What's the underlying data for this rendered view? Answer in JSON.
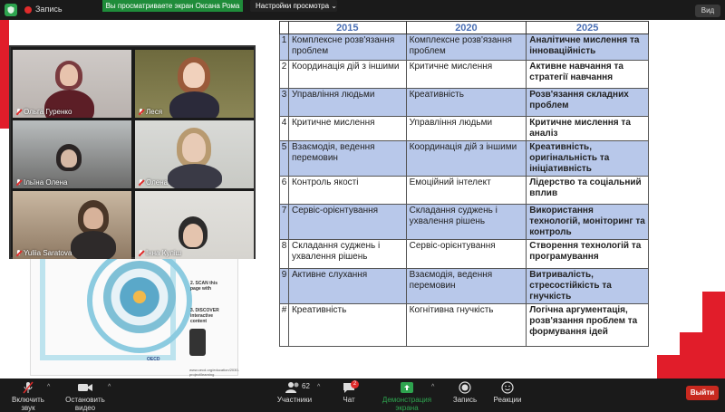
{
  "topbar": {
    "recording_label": "Запись",
    "share_banner": "Вы просматриваете экран Оксана Рома",
    "view_options": "Настройки просмотра ⌄",
    "view_button": "Вид"
  },
  "gallery": {
    "participants": [
      {
        "name": "Ольга Гуренко",
        "muted": true
      },
      {
        "name": "Леся",
        "muted": true
      },
      {
        "name": "Ільїна Олена",
        "muted": true
      },
      {
        "name": "Олена",
        "muted": true
      },
      {
        "name": "Yuliia Saratova",
        "muted": true
      },
      {
        "name": "Інна Куліш",
        "muted": true
      }
    ]
  },
  "infographic": {
    "scan_text": "2. SCAN this page with",
    "discover_text": "3. DISCOVER interactive content",
    "footer_url": "www.oecd.org/education/2030-project/learning",
    "logo_text": "OECD"
  },
  "table": {
    "headers": [
      "2015",
      "2020",
      "2025"
    ],
    "rows": [
      {
        "num": "1",
        "c2015": "Комплексне розв'язання проблем",
        "c2020": "Комплексне розв'язання проблем",
        "c2025": "Аналітичне мислення та інноваційність",
        "alt": true
      },
      {
        "num": "2",
        "c2015": "Координація дій з іншими",
        "c2020": "Критичне мислення",
        "c2025": "Активне навчання та стратегії навчання",
        "alt": false
      },
      {
        "num": "3",
        "c2015": "Управління людьми",
        "c2020": "Креативність",
        "c2025": "Розв'язання складних проблем",
        "alt": true
      },
      {
        "num": "4",
        "c2015": "Критичне мислення",
        "c2020": "Управління людьми",
        "c2025": "Критичне мислення та аналіз",
        "alt": false
      },
      {
        "num": "5",
        "c2015": "Взаємодія, ведення перемовин",
        "c2020": "Координація дій з іншими",
        "c2025": "Креативність, оригінальність та ініціативність",
        "alt": true
      },
      {
        "num": "6",
        "c2015": "Контроль якості",
        "c2020": "Емоційний інтелект",
        "c2025": "Лідерство та соціальний вплив",
        "alt": false
      },
      {
        "num": "7",
        "c2015": "Сервіс-орієнтування",
        "c2020": "Складання суджень і ухвалення рішень",
        "c2025": "Використання технологій, моніторинг та контроль",
        "alt": true
      },
      {
        "num": "8",
        "c2015": "Складання суджень і ухвалення рішень",
        "c2020": "Сервіс-орієнтування",
        "c2025": "Створення технологій та програмування",
        "alt": false
      },
      {
        "num": "9",
        "c2015": "Активне слухання",
        "c2020": "Взаємодія, ведення перемовин",
        "c2025": "Витривалість, стресостійкість та гнучкість",
        "alt": true
      },
      {
        "num": "#",
        "c2015": "Креативність",
        "c2020": "Когнітивна гнучкість",
        "c2025": "Логічна аргументація, розв'язання проблем та формування ідей",
        "alt": false
      }
    ]
  },
  "toolbar": {
    "unmute_label": "Включить звук",
    "video_label": "Остановить видео",
    "participants_label": "Участники",
    "participants_count": "62",
    "chat_label": "Чат",
    "chat_badge": "2",
    "share_label": "Демонстрация экрана",
    "record_label": "Запись",
    "reactions_label": "Реакции",
    "exit_label": "Выйти"
  },
  "colors": {
    "accent_red": "#e11d2a",
    "share_green": "#1f8c3a",
    "table_header_blue": "#4a6fb5",
    "row_highlight": "#b8c8ea"
  }
}
